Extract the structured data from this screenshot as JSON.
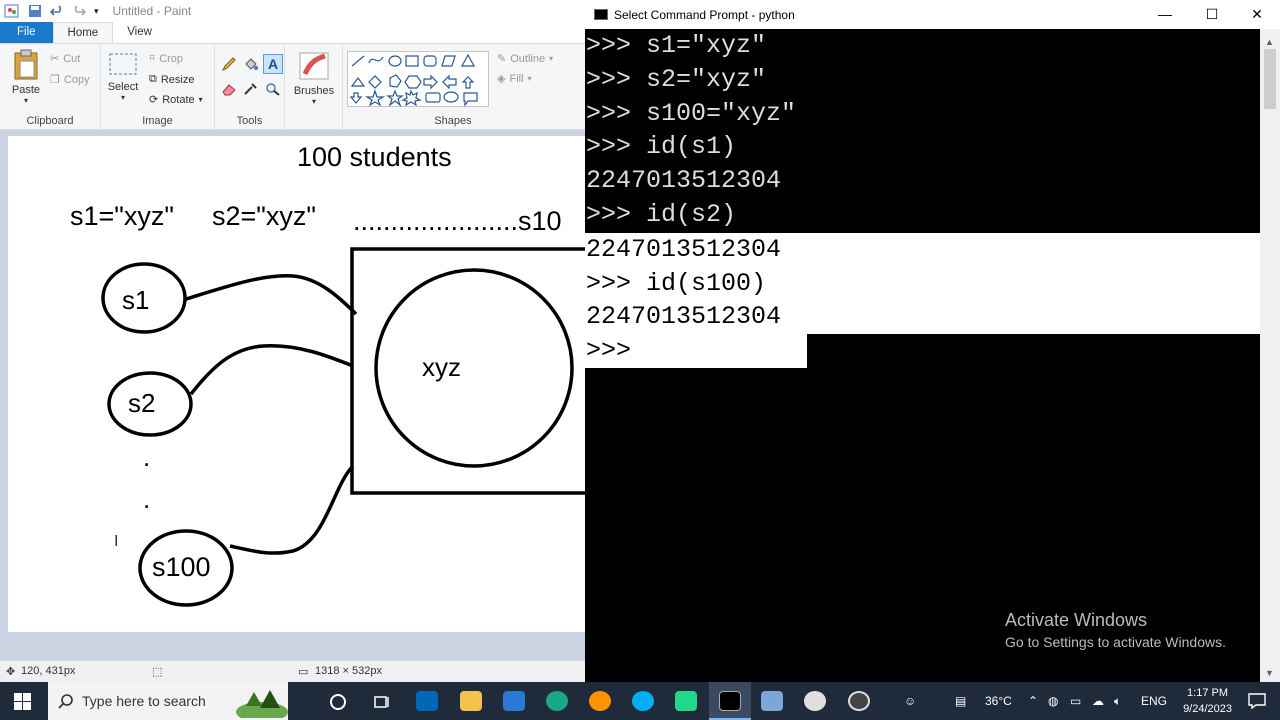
{
  "paint": {
    "title": "Untitled - Paint",
    "tabs": [
      "File",
      "Home",
      "View"
    ],
    "clipboard": {
      "paste": "Paste",
      "cut": "Cut",
      "copy": "Copy",
      "label": "Clipboard"
    },
    "image": {
      "select": "Select",
      "crop": "Crop",
      "resize": "Resize",
      "rotate": "Rotate",
      "label": "Image"
    },
    "tools": {
      "label": "Tools"
    },
    "brushes": {
      "label": "Brushes"
    },
    "shapes": {
      "outline": "Outline",
      "fill": "Fill",
      "label": "Shapes"
    },
    "drawing": {
      "heading": "100 students",
      "assign1": "s1=\"xyz\"",
      "assign2": "s2=\"xyz\"",
      "assign3": "......................s10",
      "node1": "s1",
      "node2": "s2",
      "node3": "s100",
      "dot": ".",
      "object": "xyz"
    },
    "status": {
      "cursor_pos": "120, 431px",
      "canvas_size": "1318 × 532px"
    }
  },
  "cmd": {
    "title": "Select Command Prompt - python",
    "lines": [
      ">>> s1=\"xyz\"",
      ">>> s2=\"xyz\"",
      ">>> s100=\"xyz\"",
      ">>> id(s1)",
      "2247013512304",
      ">>> id(s2)",
      "2247013512304",
      ">>> id(s100)",
      "2247013512304",
      ">>> "
    ],
    "watermark_title": "Activate Windows",
    "watermark_sub": "Go to Settings to activate Windows."
  },
  "taskbar": {
    "search_placeholder": "Type here to search",
    "temperature": "36°C",
    "language": "ENG",
    "time": "1:17 PM",
    "date": "9/24/2023"
  },
  "colors": {
    "file_tab": "#1979ca",
    "taskbar_bg": "#1f2a3a",
    "console_bg": "#000000",
    "selection": "#ffffff"
  }
}
